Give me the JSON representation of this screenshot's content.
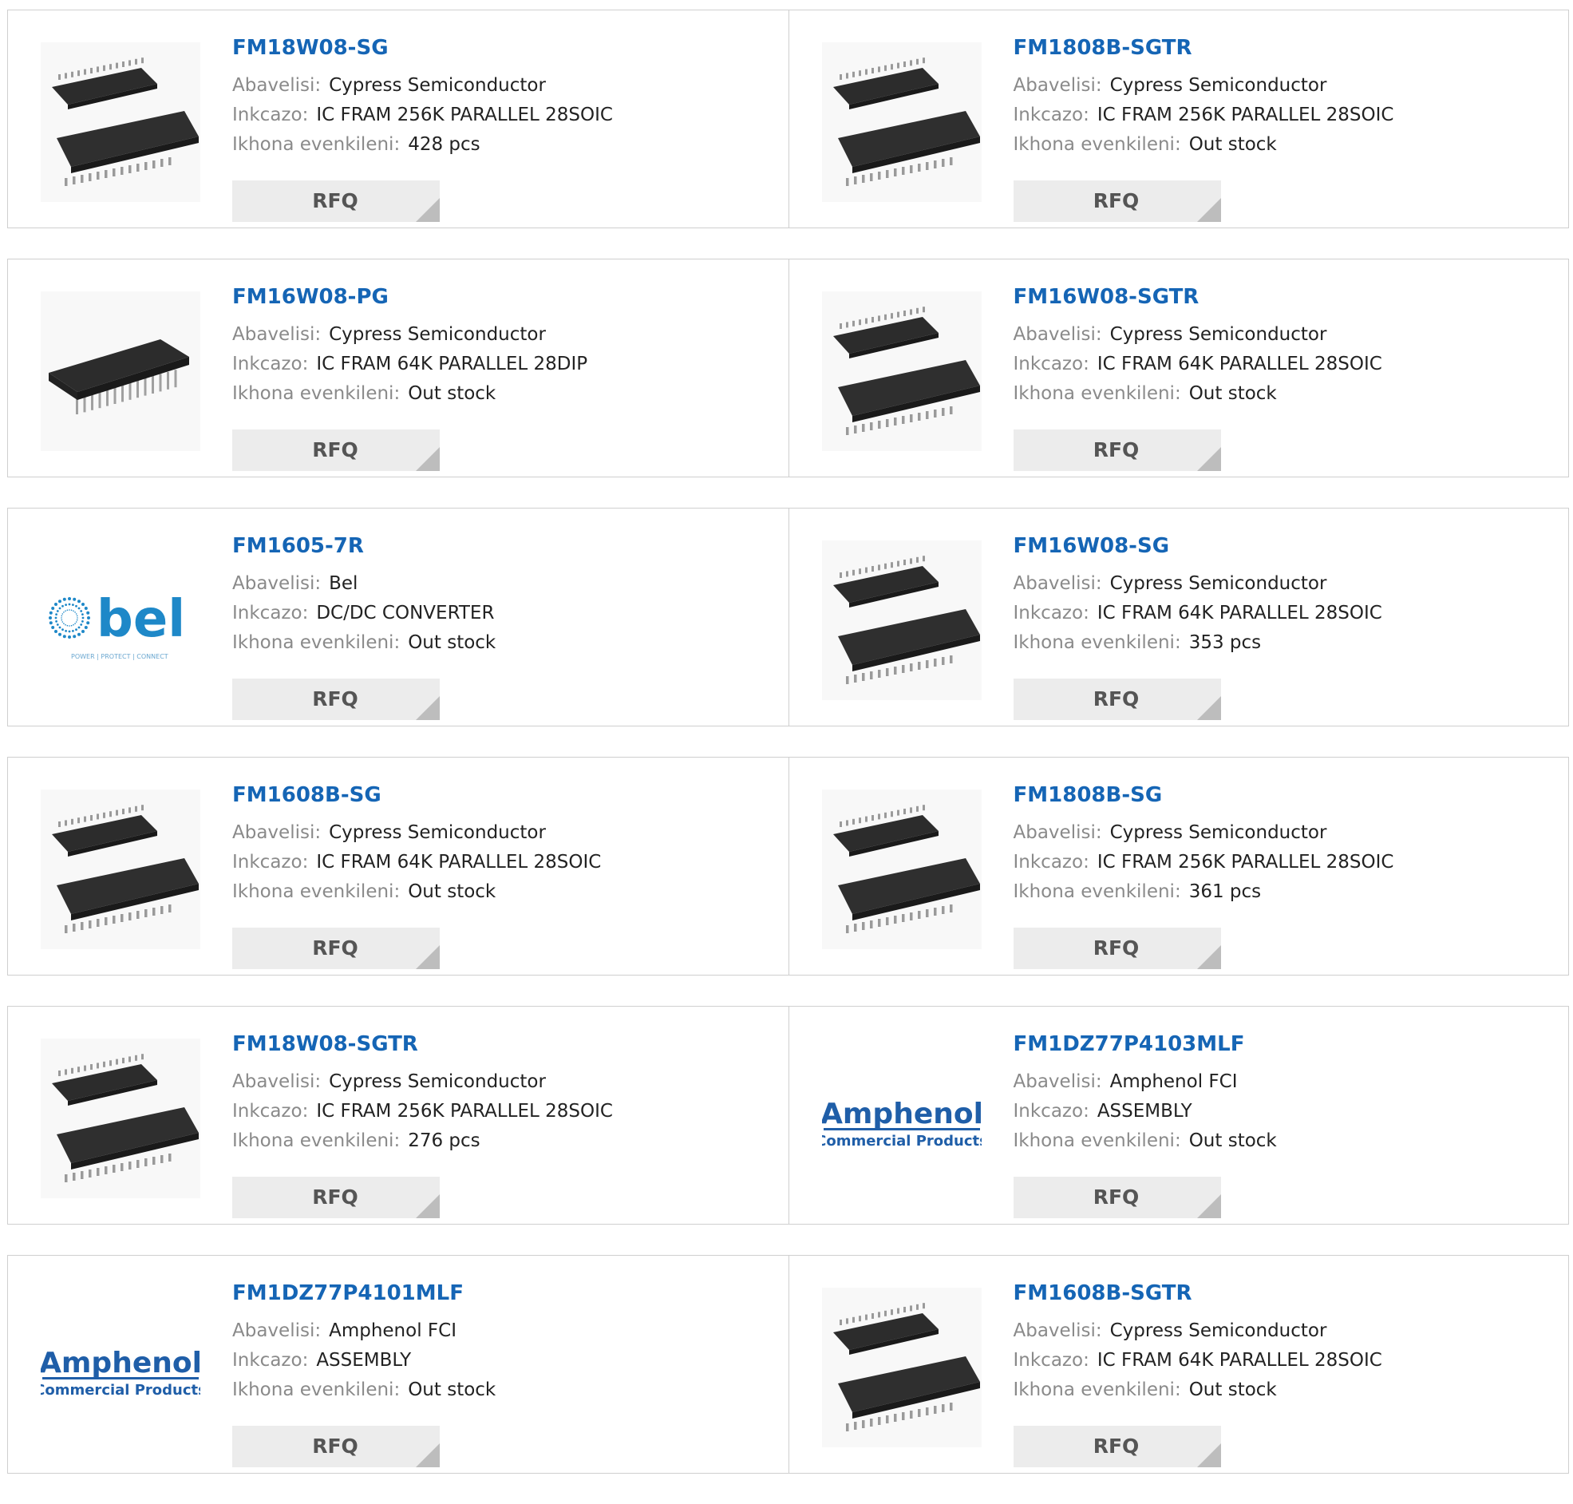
{
  "labels": {
    "manufacturer": "Abavelisi:",
    "description": "Inkcazo:",
    "stock": "Ikhona evenkileni:",
    "rfq": "RFQ"
  },
  "colors": {
    "part_link": "#1565b5",
    "label": "#8a8a8a",
    "button_bg": "#ececec"
  },
  "products": [
    {
      "part": "FM18W08-SG",
      "manufacturer": "Cypress Semiconductor",
      "description": "IC FRAM 256K PARALLEL 28SOIC",
      "stock": "428 pcs",
      "image": "soic-chip-icon"
    },
    {
      "part": "FM1808B-SGTR",
      "manufacturer": "Cypress Semiconductor",
      "description": "IC FRAM 256K PARALLEL 28SOIC",
      "stock": "Out stock",
      "image": "soic-chip-icon"
    },
    {
      "part": "FM16W08-PG",
      "manufacturer": "Cypress Semiconductor",
      "description": "IC FRAM 64K PARALLEL 28DIP",
      "stock": "Out stock",
      "image": "dip-chip-icon"
    },
    {
      "part": "FM16W08-SGTR",
      "manufacturer": "Cypress Semiconductor",
      "description": "IC FRAM 64K PARALLEL 28SOIC",
      "stock": "Out stock",
      "image": "soic-chip-icon"
    },
    {
      "part": "FM1605-7R",
      "manufacturer": "Bel",
      "description": "DC/DC CONVERTER",
      "stock": "Out stock",
      "image": "bel-logo"
    },
    {
      "part": "FM16W08-SG",
      "manufacturer": "Cypress Semiconductor",
      "description": "IC FRAM 64K PARALLEL 28SOIC",
      "stock": "353 pcs",
      "image": "soic-chip-icon"
    },
    {
      "part": "FM1608B-SG",
      "manufacturer": "Cypress Semiconductor",
      "description": "IC FRAM 64K PARALLEL 28SOIC",
      "stock": "Out stock",
      "image": "soic-chip-icon"
    },
    {
      "part": "FM1808B-SG",
      "manufacturer": "Cypress Semiconductor",
      "description": "IC FRAM 256K PARALLEL 28SOIC",
      "stock": "361 pcs",
      "image": "soic-chip-icon"
    },
    {
      "part": "FM18W08-SGTR",
      "manufacturer": "Cypress Semiconductor",
      "description": "IC FRAM 256K PARALLEL 28SOIC",
      "stock": "276 pcs",
      "image": "soic-chip-icon"
    },
    {
      "part": "FM1DZ77P4103MLF",
      "manufacturer": "Amphenol FCI",
      "description": "ASSEMBLY",
      "stock": "Out stock",
      "image": "amphenol-logo"
    },
    {
      "part": "FM1DZ77P4101MLF",
      "manufacturer": "Amphenol FCI",
      "description": "ASSEMBLY",
      "stock": "Out stock",
      "image": "amphenol-logo"
    },
    {
      "part": "FM1608B-SGTR",
      "manufacturer": "Cypress Semiconductor",
      "description": "IC FRAM 64K PARALLEL 28SOIC",
      "stock": "Out stock",
      "image": "soic-chip-icon"
    }
  ],
  "logos": {
    "bel": {
      "word": "bel",
      "tagline": "POWER | PROTECT | CONNECT"
    },
    "amphenol": {
      "word": "Amphenol",
      "tagline": "Commercial Products"
    }
  }
}
